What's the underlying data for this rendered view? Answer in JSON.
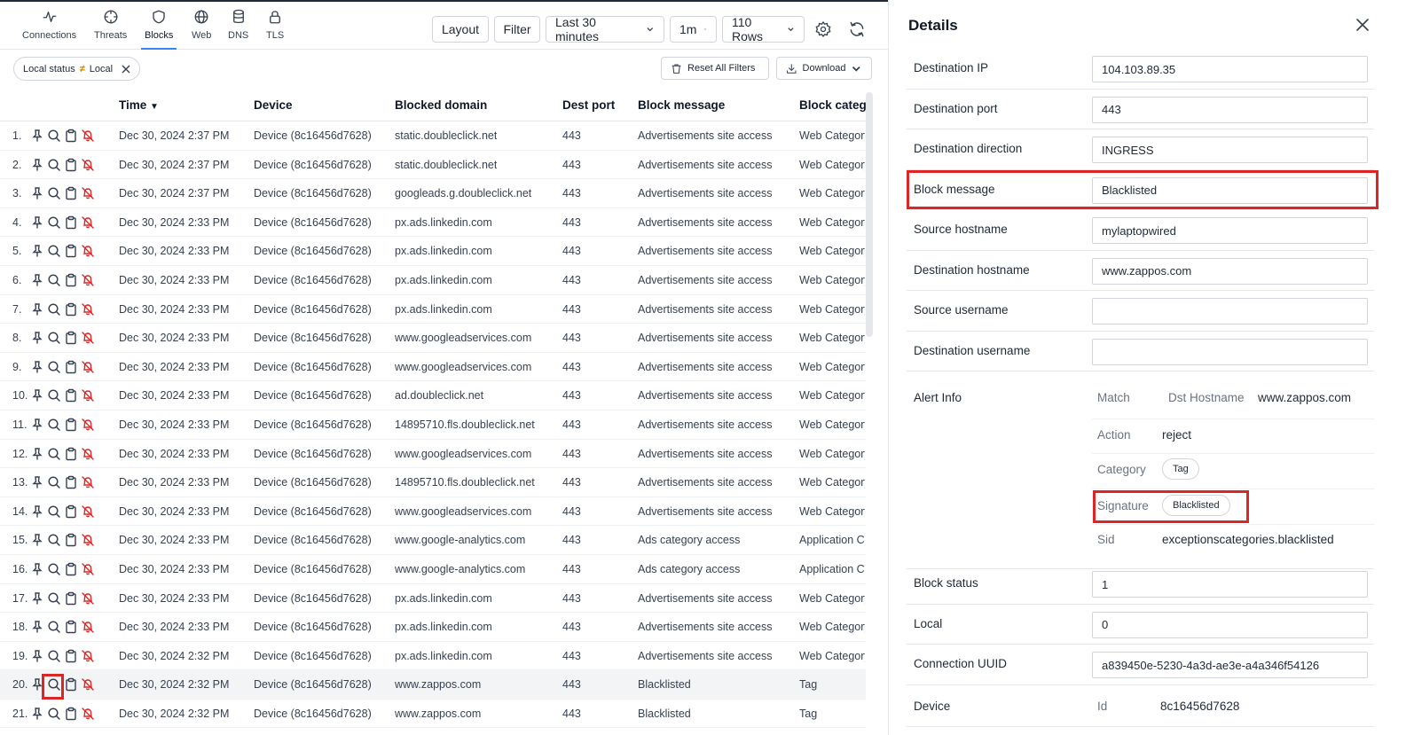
{
  "nav": {
    "tabs": [
      {
        "label": "Connections",
        "icon": "activity-icon"
      },
      {
        "label": "Threats",
        "icon": "crosshair-icon"
      },
      {
        "label": "Blocks",
        "icon": "shield-icon"
      },
      {
        "label": "Web",
        "icon": "globe-icon"
      },
      {
        "label": "DNS",
        "icon": "database-icon"
      },
      {
        "label": "TLS",
        "icon": "lock-icon"
      }
    ],
    "active_tab": "Blocks"
  },
  "toolbar": {
    "layout_label": "Layout",
    "filter_label": "Filter",
    "time_range": "Last 30 minutes",
    "interval": "1m",
    "rows": "110 Rows"
  },
  "filters": {
    "chip": {
      "field": "Local status",
      "operator": "≠",
      "value": "Local"
    },
    "reset_label": "Reset All Filters",
    "download_label": "Download"
  },
  "table": {
    "columns": [
      "Time",
      "Device",
      "Blocked domain",
      "Dest port",
      "Block message",
      "Block categ"
    ],
    "rows": [
      {
        "n": "1.",
        "time": "Dec 30, 2024 2:37 PM",
        "device": "Device (8c16456d7628)",
        "domain": "static.doubleclick.net",
        "port": "443",
        "msg": "Advertisements site access",
        "cat": "Web Category"
      },
      {
        "n": "2.",
        "time": "Dec 30, 2024 2:37 PM",
        "device": "Device (8c16456d7628)",
        "domain": "static.doubleclick.net",
        "port": "443",
        "msg": "Advertisements site access",
        "cat": "Web Category"
      },
      {
        "n": "3.",
        "time": "Dec 30, 2024 2:37 PM",
        "device": "Device (8c16456d7628)",
        "domain": "googleads.g.doubleclick.net",
        "port": "443",
        "msg": "Advertisements site access",
        "cat": "Web Category"
      },
      {
        "n": "4.",
        "time": "Dec 30, 2024 2:33 PM",
        "device": "Device (8c16456d7628)",
        "domain": "px.ads.linkedin.com",
        "port": "443",
        "msg": "Advertisements site access",
        "cat": "Web Category"
      },
      {
        "n": "5.",
        "time": "Dec 30, 2024 2:33 PM",
        "device": "Device (8c16456d7628)",
        "domain": "px.ads.linkedin.com",
        "port": "443",
        "msg": "Advertisements site access",
        "cat": "Web Category"
      },
      {
        "n": "6.",
        "time": "Dec 30, 2024 2:33 PM",
        "device": "Device (8c16456d7628)",
        "domain": "px.ads.linkedin.com",
        "port": "443",
        "msg": "Advertisements site access",
        "cat": "Web Category"
      },
      {
        "n": "7.",
        "time": "Dec 30, 2024 2:33 PM",
        "device": "Device (8c16456d7628)",
        "domain": "px.ads.linkedin.com",
        "port": "443",
        "msg": "Advertisements site access",
        "cat": "Web Category"
      },
      {
        "n": "8.",
        "time": "Dec 30, 2024 2:33 PM",
        "device": "Device (8c16456d7628)",
        "domain": "www.googleadservices.com",
        "port": "443",
        "msg": "Advertisements site access",
        "cat": "Web Category"
      },
      {
        "n": "9.",
        "time": "Dec 30, 2024 2:33 PM",
        "device": "Device (8c16456d7628)",
        "domain": "www.googleadservices.com",
        "port": "443",
        "msg": "Advertisements site access",
        "cat": "Web Category"
      },
      {
        "n": "10.",
        "time": "Dec 30, 2024 2:33 PM",
        "device": "Device (8c16456d7628)",
        "domain": "ad.doubleclick.net",
        "port": "443",
        "msg": "Advertisements site access",
        "cat": "Web Category"
      },
      {
        "n": "11.",
        "time": "Dec 30, 2024 2:33 PM",
        "device": "Device (8c16456d7628)",
        "domain": "14895710.fls.doubleclick.net",
        "port": "443",
        "msg": "Advertisements site access",
        "cat": "Web Category"
      },
      {
        "n": "12.",
        "time": "Dec 30, 2024 2:33 PM",
        "device": "Device (8c16456d7628)",
        "domain": "www.googleadservices.com",
        "port": "443",
        "msg": "Advertisements site access",
        "cat": "Web Category"
      },
      {
        "n": "13.",
        "time": "Dec 30, 2024 2:33 PM",
        "device": "Device (8c16456d7628)",
        "domain": "14895710.fls.doubleclick.net",
        "port": "443",
        "msg": "Advertisements site access",
        "cat": "Web Category"
      },
      {
        "n": "14.",
        "time": "Dec 30, 2024 2:33 PM",
        "device": "Device (8c16456d7628)",
        "domain": "www.googleadservices.com",
        "port": "443",
        "msg": "Advertisements site access",
        "cat": "Web Category"
      },
      {
        "n": "15.",
        "time": "Dec 30, 2024 2:33 PM",
        "device": "Device (8c16456d7628)",
        "domain": "www.google-analytics.com",
        "port": "443",
        "msg": "Ads category access",
        "cat": "Application C"
      },
      {
        "n": "16.",
        "time": "Dec 30, 2024 2:33 PM",
        "device": "Device (8c16456d7628)",
        "domain": "www.google-analytics.com",
        "port": "443",
        "msg": "Ads category access",
        "cat": "Application C"
      },
      {
        "n": "17.",
        "time": "Dec 30, 2024 2:33 PM",
        "device": "Device (8c16456d7628)",
        "domain": "px.ads.linkedin.com",
        "port": "443",
        "msg": "Advertisements site access",
        "cat": "Web Category"
      },
      {
        "n": "18.",
        "time": "Dec 30, 2024 2:33 PM",
        "device": "Device (8c16456d7628)",
        "domain": "px.ads.linkedin.com",
        "port": "443",
        "msg": "Advertisements site access",
        "cat": "Web Category"
      },
      {
        "n": "19.",
        "time": "Dec 30, 2024 2:32 PM",
        "device": "Device (8c16456d7628)",
        "domain": "px.ads.linkedin.com",
        "port": "443",
        "msg": "Advertisements site access",
        "cat": "Web Category"
      },
      {
        "n": "20.",
        "time": "Dec 30, 2024 2:32 PM",
        "device": "Device (8c16456d7628)",
        "domain": "www.zappos.com",
        "port": "443",
        "msg": "Blacklisted",
        "cat": "Tag"
      },
      {
        "n": "21.",
        "time": "Dec 30, 2024 2:32 PM",
        "device": "Device (8c16456d7628)",
        "domain": "www.zappos.com",
        "port": "443",
        "msg": "Blacklisted",
        "cat": "Tag"
      }
    ]
  },
  "details": {
    "title": "Details",
    "fields_top": [
      {
        "label": "Destination IP",
        "value": "104.103.89.35"
      },
      {
        "label": "Destination port",
        "value": "443"
      },
      {
        "label": "Destination direction",
        "value": "INGRESS"
      },
      {
        "label": "Block message",
        "value": "Blacklisted"
      },
      {
        "label": "Source hostname",
        "value": "mylaptopwired"
      },
      {
        "label": "Destination hostname",
        "value": "www.zappos.com"
      },
      {
        "label": "Source username",
        "value": ""
      },
      {
        "label": "Destination username",
        "value": ""
      }
    ],
    "alert_info": {
      "label": "Alert Info",
      "match_label": "Match",
      "match_key": "Dst Hostname",
      "match_value": "www.zappos.com",
      "action_label": "Action",
      "action_value": "reject",
      "category_label": "Category",
      "category_value": "Tag",
      "signature_label": "Signature",
      "signature_value": "Blacklisted",
      "sid_label": "Sid",
      "sid_value": "exceptionscategories.blacklisted"
    },
    "fields_bottom": [
      {
        "label": "Block status",
        "value": "1"
      },
      {
        "label": "Local",
        "value": "0"
      },
      {
        "label": "Connection UUID",
        "value": "a839450e-5230-4a3d-ae3e-a4a346f54126"
      }
    ],
    "device": {
      "label": "Device",
      "id_label": "Id",
      "id_value": "8c16456d7628"
    }
  },
  "colors": {
    "highlight": "#dc2626",
    "active_tab": "#3b82f6",
    "chip_operator": "#ca8a04"
  }
}
